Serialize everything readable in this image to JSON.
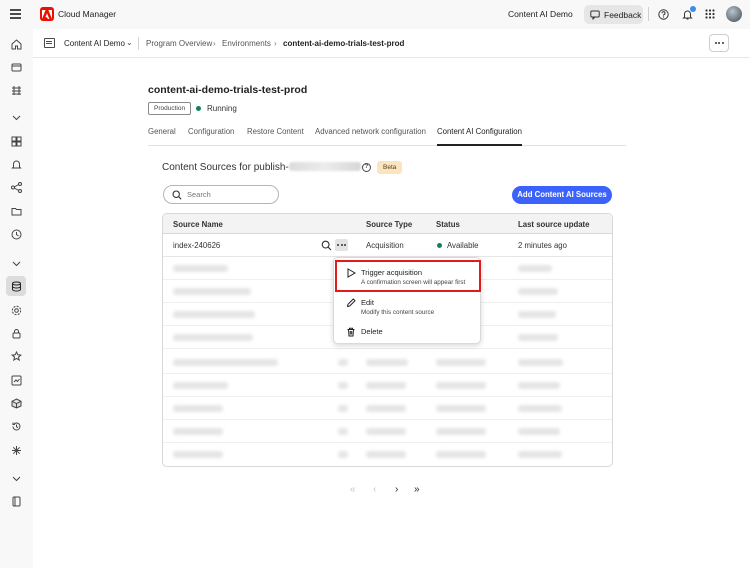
{
  "app": {
    "title": "Cloud Manager",
    "org": "Content AI Demo",
    "feedback_label": "Feedback"
  },
  "breadcrumb": {
    "program": "Content AI Demo",
    "items": [
      "Program Overview",
      "Environments",
      "content-ai-demo-trials-test-prod"
    ]
  },
  "environment": {
    "title": "content-ai-demo-trials-test-prod",
    "badge": "Production",
    "status": "Running"
  },
  "tabs": [
    "General",
    "Configuration",
    "Restore Content",
    "Advanced network configuration",
    "Content AI Configuration"
  ],
  "content_sources": {
    "title": "Content Sources for publish-",
    "beta": "Beta",
    "search_placeholder": "Search",
    "add_button": "Add Content AI Sources",
    "columns": [
      "Source Name",
      "Source Type",
      "Status",
      "Last source update"
    ],
    "rows": [
      {
        "name": "index-240626",
        "type": "Acquisition",
        "status": "Available",
        "updated": "2 minutes ago"
      }
    ]
  },
  "context_menu": [
    {
      "label": "Trigger acquisition",
      "description": "A confirmation screen will appear first",
      "icon": "play-icon"
    },
    {
      "label": "Edit",
      "description": "Modify this content source",
      "icon": "pencil-icon"
    },
    {
      "label": "Delete",
      "description": "",
      "icon": "trash-icon"
    }
  ],
  "pagination": {
    "first": "«",
    "prev": "‹",
    "next": "›",
    "last": "»"
  },
  "colors": {
    "accent": "#3b63fb",
    "brand": "#eb1000",
    "status_ok": "#12805c",
    "highlight": "#e01b1b",
    "beta_bg": "#fbe4c2"
  }
}
